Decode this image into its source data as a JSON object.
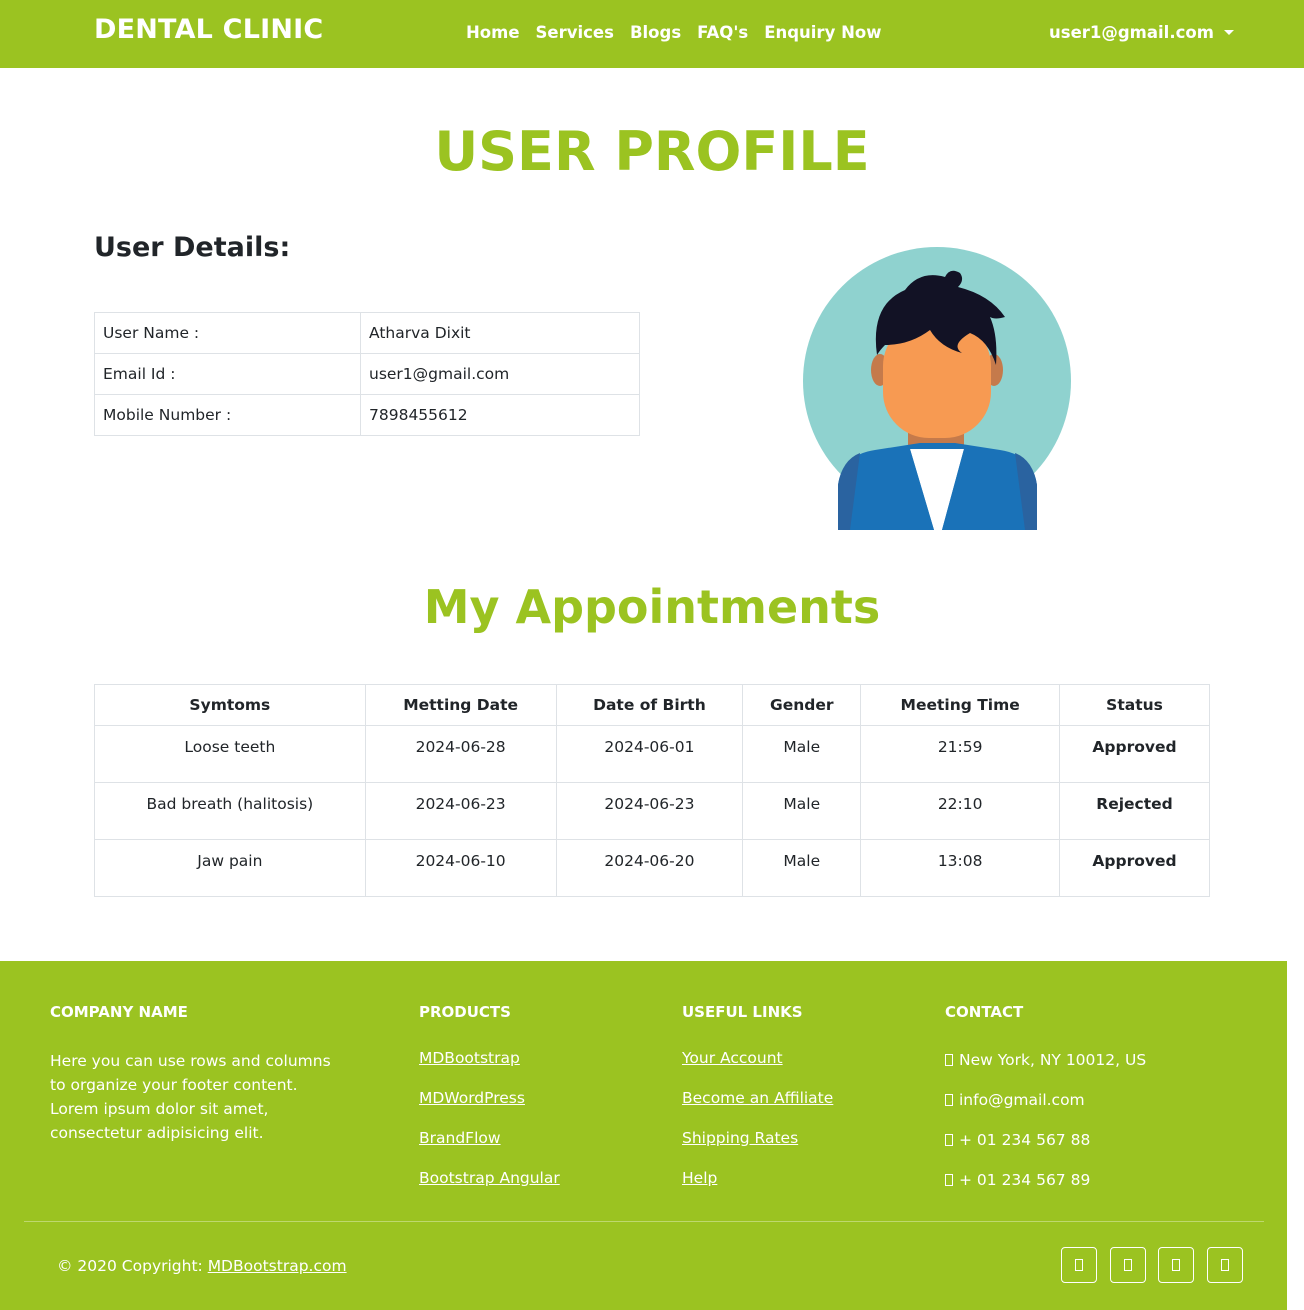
{
  "navbar": {
    "brand": "DENTAL CLINIC",
    "links": [
      "Home",
      "Services",
      "Blogs",
      "FAQ's",
      "Enquiry Now"
    ],
    "user": "user1@gmail.com"
  },
  "page": {
    "title": "USER PROFILE",
    "details_heading": "User Details:",
    "details": [
      {
        "label": "User Name :",
        "value": "Atharva Dixit"
      },
      {
        "label": "Email Id :",
        "value": "user1@gmail.com"
      },
      {
        "label": "Mobile Number :",
        "value": "7898455612"
      }
    ],
    "appointments_title": "My Appointments"
  },
  "appointments": {
    "headers": [
      "Symtoms",
      "Metting Date",
      "Date of Birth",
      "Gender",
      "Meeting Time",
      "Status"
    ],
    "rows": [
      [
        "Loose teeth",
        "2024-06-28",
        "2024-06-01",
        "Male",
        "21:59",
        "Approved"
      ],
      [
        "Bad breath (halitosis)",
        "2024-06-23",
        "2024-06-23",
        "Male",
        "22:10",
        "Rejected"
      ],
      [
        "Jaw pain",
        "2024-06-10",
        "2024-06-20",
        "Male",
        "13:08",
        "Approved"
      ]
    ]
  },
  "footer": {
    "company_heading": "COMPANY NAME",
    "company_text": "Here you can use rows and columns to organize your footer content. Lorem ipsum dolor sit amet, consectetur adipisicing elit.",
    "products_heading": "PRODUCTS",
    "products": [
      "MDBootstrap",
      "MDWordPress",
      "BrandFlow",
      "Bootstrap Angular"
    ],
    "links_heading": "USEFUL LINKS",
    "links": [
      "Your Account",
      "Become an Affiliate",
      "Shipping Rates",
      "Help"
    ],
    "contact_heading": "CONTACT",
    "contact": [
      "New York, NY 10012, US",
      "info@gmail.com",
      "+ 01 234 567 88",
      "+ 01 234 567 89"
    ],
    "copyright_prefix": "© 2020 Copyright: ",
    "copyright_link": "MDBootstrap.com",
    "social_icons": [
      "facebook-icon",
      "twitter-icon",
      "google-icon",
      "instagram-icon"
    ]
  },
  "colors": {
    "brand": "#9bc321",
    "approved": "#198754",
    "rejected": "#dc3545"
  }
}
